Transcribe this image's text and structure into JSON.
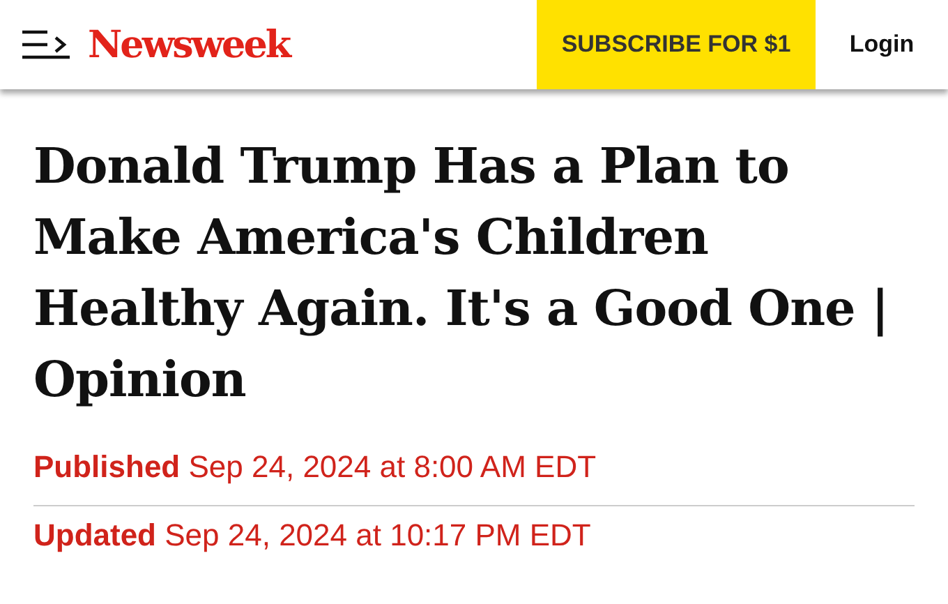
{
  "header": {
    "logo": "Newsweek",
    "subscribe_button": "SUBSCRIBE FOR $1",
    "login_button": "Login"
  },
  "article": {
    "headline": "Donald Trump Has a Plan to Make America's Children Healthy Again. It's a Good One | Opinion",
    "published": "**Published** Sep 24, 2024 at 8:00 AM EDT",
    "updated": "**Updated** Sep 24, 2024 at 10:17 PM EDT"
  }
}
